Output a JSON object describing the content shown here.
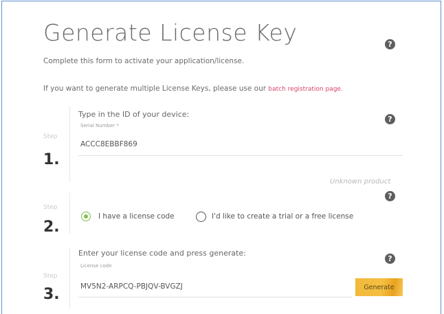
{
  "title": "Generate License Key",
  "subtitle": "Complete this form to activate your application/license.",
  "multiple_prefix": "If you want to generate multiple License Keys, please use our",
  "batch_link": "batch registration page.",
  "help_glyph": "?",
  "steps": [
    {
      "label": "Step",
      "number": "1.",
      "prompt": "Type in the ID of your device:",
      "field_label": "Serial Number *",
      "field_value": "ACCC8EBBF869"
    },
    {
      "label": "Step",
      "number": "2.",
      "status": "Unknown product",
      "option_1": "I have a license code",
      "option_2": "I'd like to create a trial or a free license"
    },
    {
      "label": "Step",
      "number": "3.",
      "prompt": "Enter your license code and press generate:",
      "field_label": "License code",
      "field_value": "MV5N2-ARPCQ-PBJQV-BVGZJ",
      "button": "Generate"
    }
  ],
  "colors": {
    "frame": "#5b8fd0",
    "link": "#d6446a",
    "radio_selected": "#7fbf4d",
    "button": "#f4bf42"
  }
}
